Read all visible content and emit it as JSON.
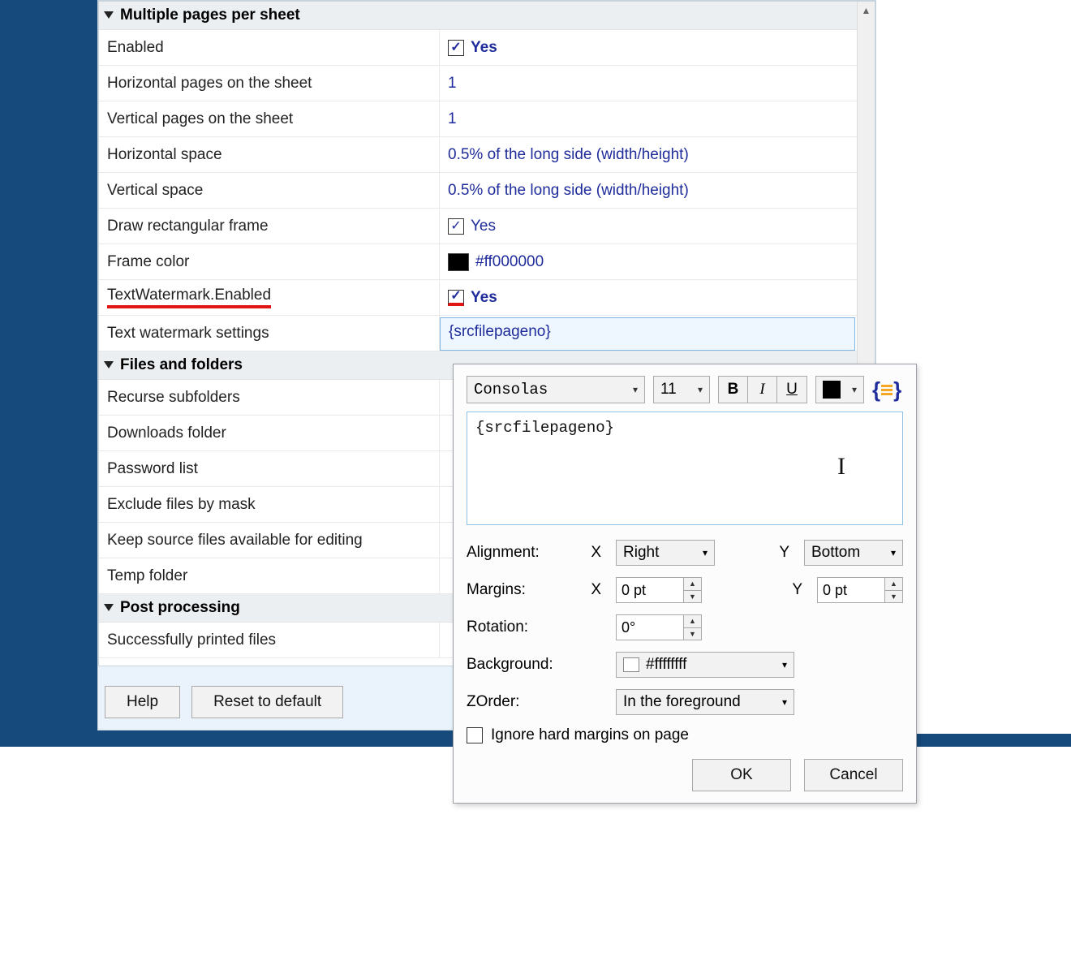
{
  "sections": {
    "multiple_pages": {
      "title": "Multiple pages per sheet",
      "rows": {
        "enabled": {
          "label": "Enabled",
          "value": "Yes",
          "checked": true
        },
        "hp": {
          "label": "Horizontal pages on the sheet",
          "value": "1"
        },
        "vp": {
          "label": "Vertical pages on the sheet",
          "value": "1"
        },
        "hs": {
          "label": "Horizontal space",
          "value": "0.5% of the long side (width/height)"
        },
        "vs": {
          "label": "Vertical space",
          "value": "0.5% of the long side (width/height)"
        },
        "frame": {
          "label": "Draw rectangular frame",
          "value": "Yes",
          "checked": true
        },
        "framecolor": {
          "label": "Frame color",
          "value": "#ff000000",
          "swatch": "#000000"
        },
        "twenabled": {
          "label": "TextWatermark.Enabled",
          "value": "Yes",
          "checked": true
        },
        "twsettings": {
          "label": "Text watermark settings",
          "value": "{srcfilepageno}"
        }
      }
    },
    "files_folders": {
      "title": "Files and folders",
      "rows": {
        "recurse": {
          "label": "Recurse subfolders"
        },
        "downloads": {
          "label": "Downloads folder"
        },
        "password": {
          "label": "Password list"
        },
        "exclude": {
          "label": "Exclude files by mask"
        },
        "keep": {
          "label": "Keep source files available for editing"
        },
        "temp": {
          "label": "Temp folder"
        }
      }
    },
    "post_processing": {
      "title": "Post processing",
      "rows": {
        "printed": {
          "label": "Successfully printed files"
        }
      }
    }
  },
  "buttons": {
    "help": "Help",
    "reset": "Reset to default"
  },
  "popup": {
    "font": "Consolas",
    "size": "11",
    "bold": "B",
    "italic": "I",
    "underline": "U",
    "text": "{srcfilepageno}",
    "alignment_label": "Alignment:",
    "margins_label": "Margins:",
    "rotation_label": "Rotation:",
    "background_label": "Background:",
    "zorder_label": "ZOrder:",
    "x_label": "X",
    "y_label": "Y",
    "align_x": "Right",
    "align_y": "Bottom",
    "margin_x": "0 pt",
    "margin_y": "0 pt",
    "rotation": "0°",
    "background": "#ffffffff",
    "zorder": "In the foreground",
    "ignore": "Ignore hard margins on page",
    "ok": "OK",
    "cancel": "Cancel"
  }
}
